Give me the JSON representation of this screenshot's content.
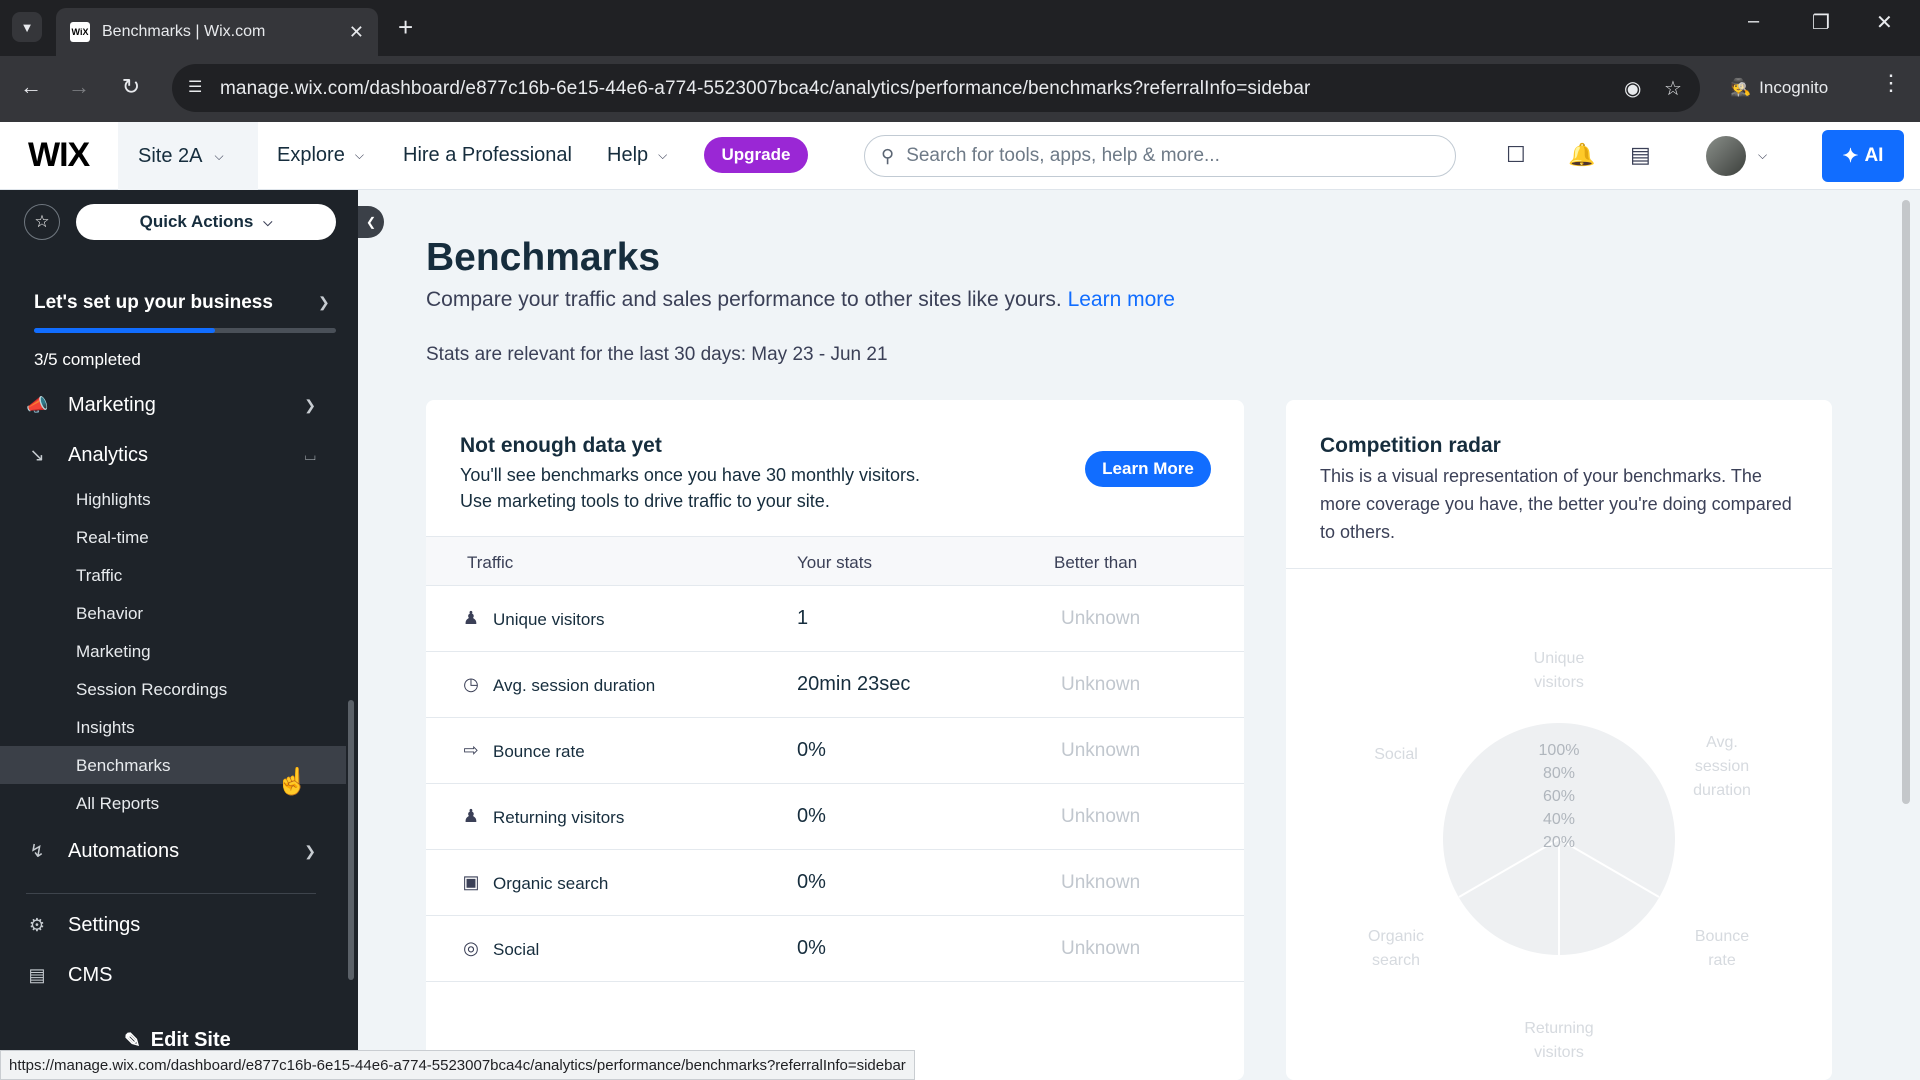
{
  "browser": {
    "tab_title": "Benchmarks | Wix.com",
    "url": "manage.wix.com/dashboard/e877c16b-6e15-44e6-a774-5523007bca4c/analytics/performance/benchmarks?referralInfo=sidebar",
    "incognito_label": "Incognito",
    "status_url": "https://manage.wix.com/dashboard/e877c16b-6e15-44e6-a774-5523007bca4c/analytics/performance/benchmarks?referralInfo=sidebar"
  },
  "topbar": {
    "logo": "WIX",
    "site_name": "Site 2A",
    "nav": {
      "explore": "Explore",
      "hire": "Hire a Professional",
      "help": "Help"
    },
    "upgrade_label": "Upgrade",
    "search_placeholder": "Search for tools, apps, help & more...",
    "ai_label": "AI"
  },
  "sidebar": {
    "quick_actions": "Quick Actions",
    "setup_title": "Let's set up your business",
    "setup_progress": 0.6,
    "setup_count": "3/5 completed",
    "marketing": "Marketing",
    "analytics": "Analytics",
    "analytics_items": [
      "Highlights",
      "Real-time",
      "Traffic",
      "Behavior",
      "Marketing",
      "Session Recordings",
      "Insights",
      "Benchmarks",
      "All Reports"
    ],
    "automations": "Automations",
    "settings": "Settings",
    "cms": "CMS",
    "edit_site": "Edit Site"
  },
  "main": {
    "title": "Benchmarks",
    "subtitle": "Compare your traffic and sales performance to other sites like yours.",
    "learn_more_link": "Learn more",
    "stats_range": "Stats are relevant for the last 30 days: May 23 - Jun 21"
  },
  "not_enough": {
    "title": "Not enough data yet",
    "line1": "You'll see benchmarks once you have 30 monthly visitors.",
    "line2": "Use marketing tools to drive traffic to your site.",
    "button": "Learn More"
  },
  "table": {
    "headers": {
      "traffic": "Traffic",
      "your_stats": "Your stats",
      "better_than": "Better than"
    },
    "rows": [
      {
        "label": "Unique visitors",
        "stat": "1",
        "better": "Unknown"
      },
      {
        "label": "Avg. session duration",
        "stat": "20min 23sec",
        "better": "Unknown"
      },
      {
        "label": "Bounce rate",
        "stat": "0%",
        "better": "Unknown"
      },
      {
        "label": "Returning visitors",
        "stat": "0%",
        "better": "Unknown"
      },
      {
        "label": "Organic search",
        "stat": "0%",
        "better": "Unknown"
      },
      {
        "label": "Social",
        "stat": "0%",
        "better": "Unknown"
      }
    ]
  },
  "radar": {
    "title": "Competition radar",
    "description": "This is a visual representation of your benchmarks. The more coverage you have, the better you're doing compared to others.",
    "axes": {
      "unique_1": "Unique",
      "unique_2": "visitors",
      "avg_1": "Avg.",
      "avg_2": "session",
      "avg_3": "duration",
      "bounce_1": "Bounce",
      "bounce_2": "rate",
      "returning_1": "Returning",
      "returning_2": "visitors",
      "organic_1": "Organic",
      "organic_2": "search",
      "social": "Social"
    },
    "scale": [
      "100%",
      "80%",
      "60%",
      "40%",
      "20%"
    ]
  }
}
